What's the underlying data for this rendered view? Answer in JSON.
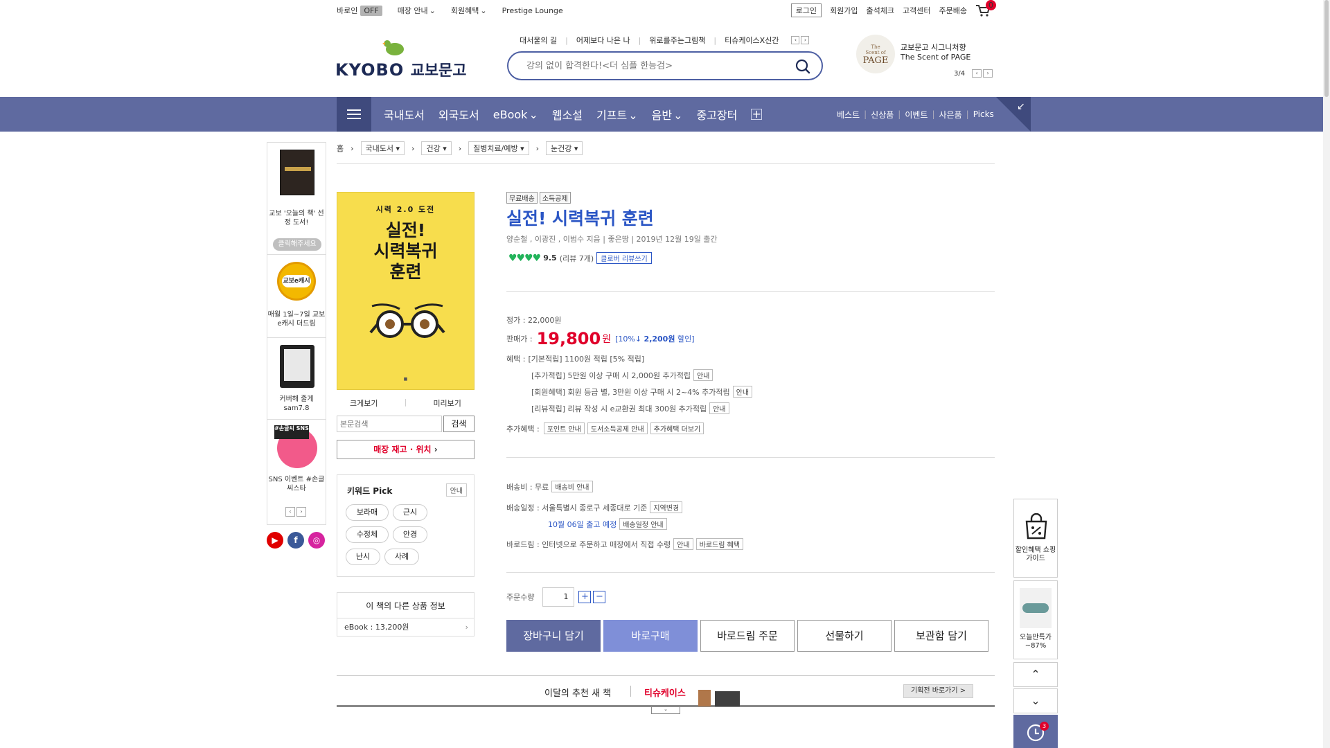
{
  "topbar": {
    "baroin_label": "바로인",
    "baroin_state": "OFF",
    "store_info": "매장 안내",
    "member_benefit": "회원혜택",
    "prestige": "Prestige Lounge",
    "login": "로그인",
    "signup": "회원가입",
    "attendance": "출석체크",
    "customer_center": "고객센터",
    "order_delivery": "주문배송",
    "cart_count": "0"
  },
  "header": {
    "logo_en": "KYOBO",
    "logo_kr": "교보문고",
    "hot_keywords": [
      "대서울의 길",
      "어제보다 나은 나",
      "위로를주는그림책",
      "티슈케이스X신간"
    ],
    "search_placeholder": "강의 없이 합격한다!<더 심플 한능검>",
    "promo_line1": "교보문고 시그니처향",
    "promo_line2": "The Scent of PAGE",
    "promo_logo": "The Scent of PAGE",
    "promo_page": "3/4"
  },
  "catnav": {
    "items": [
      "국내도서",
      "외국도서",
      "eBook",
      "웹소설",
      "기프트",
      "음반",
      "중고장터"
    ],
    "right_items": [
      "베스트",
      "신상품",
      "이벤트",
      "사은품",
      "Picks"
    ]
  },
  "side_banners": [
    {
      "caption": "교보 '오늘의 책' 선정 도서!",
      "button": "클릭해주세요"
    },
    {
      "caption": "매월 1일~7일 교보e캐시 더드림",
      "logo": "교보e캐시"
    },
    {
      "caption": "커버해 줄게 sam7.8"
    },
    {
      "caption": "SNS 이벤트 #손글씨스타",
      "logo": "#손글씨 SNS"
    }
  ],
  "breadcrumb": {
    "home": "홈",
    "levels": [
      "국내도서",
      "건강",
      "질병치료/예방",
      "눈건강"
    ]
  },
  "book": {
    "cover_series": "시력 2.0 도전",
    "cover_title_line1": "실전!",
    "cover_title_line2": "시력복귀",
    "cover_title_line3": "훈련",
    "zoom": "크게보기",
    "preview": "미리보기",
    "text_search_placeholder": "본문검색",
    "text_search_button": "검색",
    "store_stock": "매장 재고 · 위치",
    "keyword_title": "키워드 Pick",
    "keyword_info": "안내",
    "keywords": [
      "보라매",
      "근시",
      "수정체",
      "안경",
      "난시",
      "사례"
    ],
    "other_title": "이 책의 다른 상품 정보",
    "other_ebook": "eBook : 13,200원"
  },
  "product": {
    "badges": [
      "무료배송",
      "소득공제"
    ],
    "title": "실전! 시력복귀 훈련",
    "meta": "양순철 , 이광진 , 이범수 지음 | 좋은땅 | 2019년 12월 19일 출간",
    "rating": "9.5",
    "review_count": "(리뷰 7개)",
    "review_button": "클로버 리뷰쓰기",
    "list_price": "정가 : 22,000원",
    "sale_label": "판매가 :",
    "sale_price": "19,800",
    "sale_unit": "원",
    "discount_open": "[10%↓ ",
    "discount_amount": "2,200원",
    "discount_close": " 할인]",
    "benefit_label": "혜택 :",
    "benefit_basic": "[기본적립] 1100원 적립 [5% 적립]",
    "benefit_extra": "[추가적립] 5만원 이상 구매 시 2,000원 추가적립",
    "benefit_member": "[회원혜택] 회원 등급 별, 3만원 이상 구매 시 2~4% 추가적립",
    "benefit_review": "[리뷰적립] 리뷰 작성 시 e교환권 최대 300원 추가적립",
    "info_btn": "안내",
    "extra_label": "추가혜택 :",
    "extra_buttons": [
      "포인트 안내",
      "도서소득공제 안내",
      "추가혜택 더보기"
    ],
    "shipping_fee": "배송비 : 무료",
    "shipping_info_btn": "배송비 안내",
    "schedule_label": "배송일정 : 서울특별시 종로구 세종대로 기준",
    "region_btn": "지역변경",
    "schedule_date": "10월 06일 출고 예정",
    "schedule_btn": "배송일정 안내",
    "barodrim": "바로드림 : 인터넷으로 주문하고 매장에서 직접 수령",
    "barodrim_benefit": "바로드림 혜택",
    "qty_label": "주문수량",
    "qty_value": "1",
    "actions": [
      "장바구니 담기",
      "바로구매",
      "바로드림 주문",
      "선물하기",
      "보관함 담기"
    ]
  },
  "recommend": {
    "title": "이달의 추천 새 책",
    "link": "티슈케이스",
    "more": "기획전 바로가기 >"
  },
  "float_panel": {
    "guide_caption": "할인혜택 쇼핑가이드",
    "deal_caption": "오늘만특가 ~87%",
    "recent_count": "3"
  }
}
